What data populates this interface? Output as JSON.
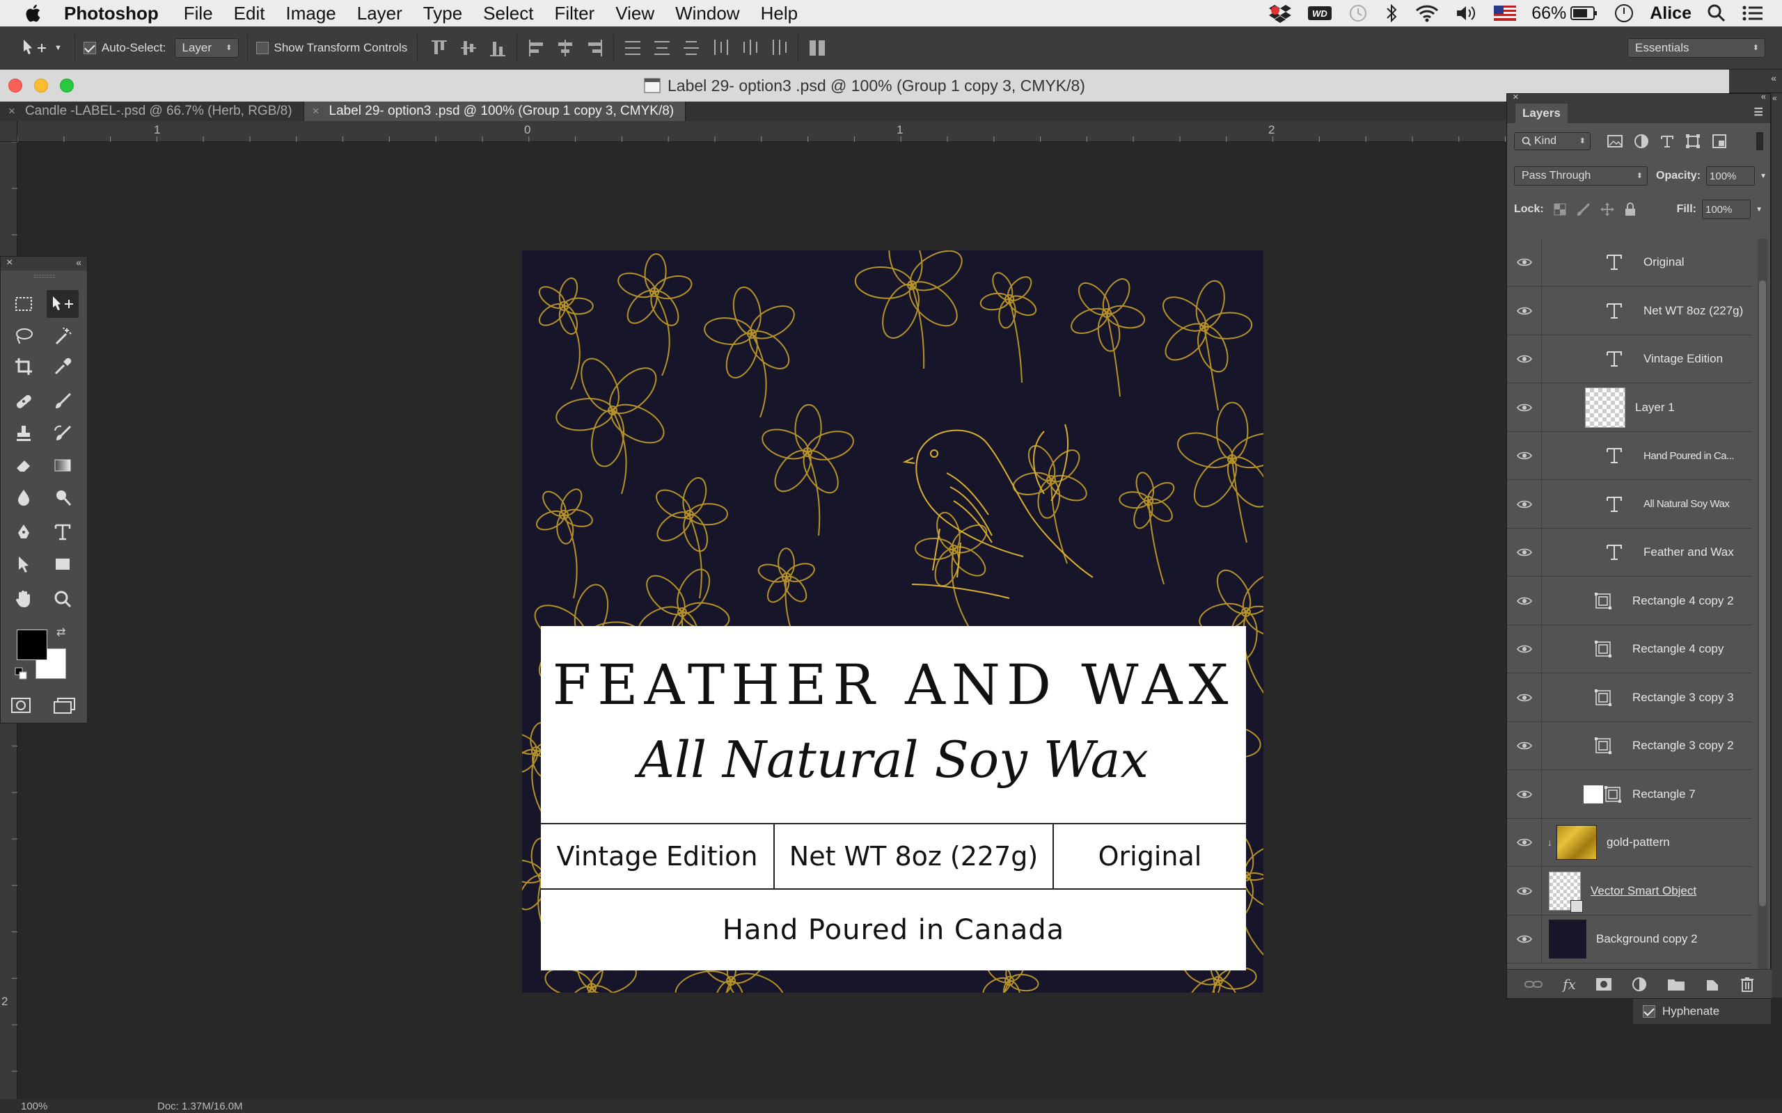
{
  "menubar": {
    "app_name": "Photoshop",
    "items": [
      "File",
      "Edit",
      "Image",
      "Layer",
      "Type",
      "Select",
      "Filter",
      "View",
      "Window",
      "Help"
    ],
    "status": {
      "battery": "66%",
      "user": "Alice"
    }
  },
  "options_bar": {
    "auto_select_label": "Auto-Select:",
    "auto_select_value": "Layer",
    "show_transform_label": "Show Transform Controls",
    "workspace": "Essentials"
  },
  "document": {
    "title": "Label 29- option3 .psd @ 100% (Group 1 copy 3, CMYK/8)",
    "tabs": [
      {
        "label": "Candle -LABEL-.psd @ 66.7% (Herb, RGB/8)",
        "active": false
      },
      {
        "label": "Label 29- option3 .psd @ 100% (Group 1 copy 3, CMYK/8)",
        "active": true
      }
    ],
    "ruler_labels": [
      "1",
      "0",
      "1",
      "2"
    ],
    "vruler_label": "2"
  },
  "label": {
    "brand": "FEATHER AND WAX",
    "tagline": "All Natural Soy Wax",
    "edition": "Vintage Edition",
    "weight": "Net WT 8oz (227g)",
    "scent": "Original",
    "origin": "Hand Poured in Canada"
  },
  "layers_panel": {
    "title": "Layers",
    "kind": "Kind",
    "blend_mode": "Pass Through",
    "opacity_label": "Opacity:",
    "opacity": "100%",
    "lock_label": "Lock:",
    "fill_label": "Fill:",
    "fill": "100%",
    "layers": [
      {
        "name": "Original",
        "type": "text"
      },
      {
        "name": "Net WT 8oz (227g)",
        "type": "text"
      },
      {
        "name": "Vintage Edition",
        "type": "text"
      },
      {
        "name": "Layer 1",
        "type": "pixel"
      },
      {
        "name": "Hand Poured in Ca...",
        "type": "text"
      },
      {
        "name": "All Natural Soy Wax",
        "type": "text"
      },
      {
        "name": "Feather and Wax",
        "type": "text"
      },
      {
        "name": "Rectangle 4 copy 2",
        "type": "shape"
      },
      {
        "name": "Rectangle 4 copy",
        "type": "shape"
      },
      {
        "name": "Rectangle 3 copy 3",
        "type": "shape"
      },
      {
        "name": "Rectangle 3 copy 2",
        "type": "shape"
      },
      {
        "name": "Rectangle 7",
        "type": "shape-white"
      },
      {
        "name": "gold-pattern",
        "type": "gold"
      },
      {
        "name": "Vector Smart Object",
        "type": "smart"
      },
      {
        "name": "Background copy 2",
        "type": "dark"
      }
    ],
    "hyphenate": "Hyphenate"
  },
  "status_bar": {
    "zoom": "100%",
    "doc": "Doc: 1.37M/16.0M"
  },
  "colors": {
    "menubar": "#ececec",
    "panel": "#535353",
    "canvas": "#282828",
    "navy": "#16152a",
    "gold": "#c9a227"
  }
}
